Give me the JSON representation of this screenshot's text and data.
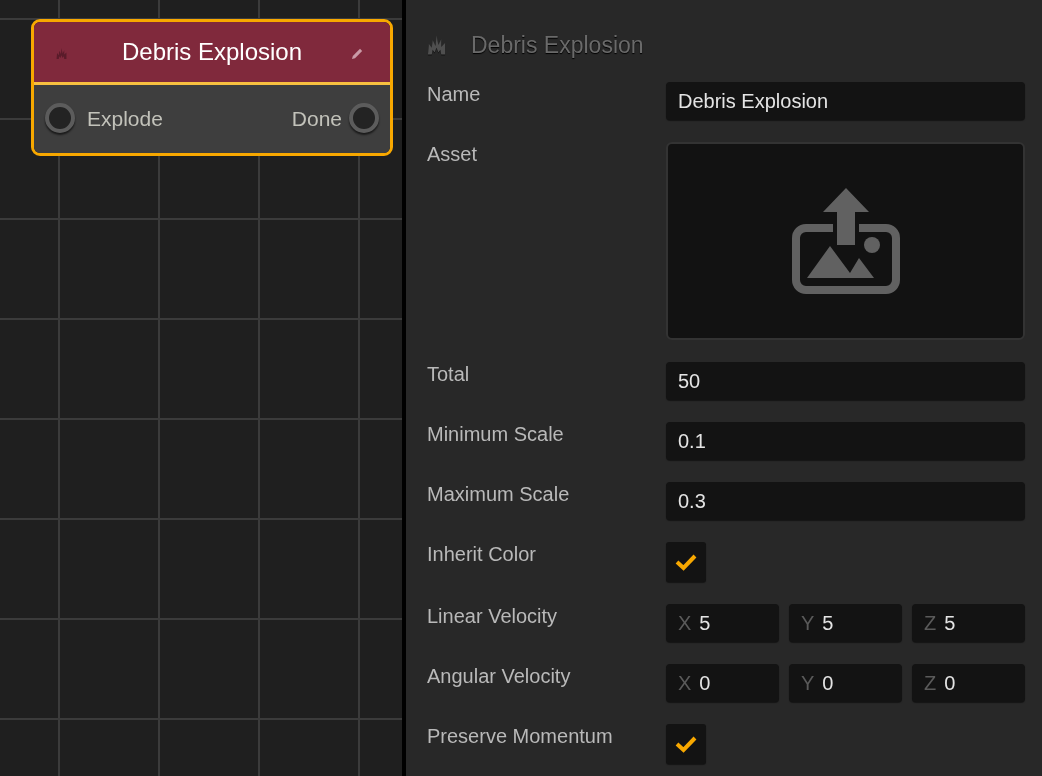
{
  "node": {
    "title": "Debris Explosion",
    "selected": true,
    "inputs": [
      {
        "label": "Explode"
      }
    ],
    "outputs": [
      {
        "label": "Done"
      }
    ]
  },
  "inspector": {
    "title": "Debris Explosion",
    "properties": [
      {
        "kind": "text",
        "label": "Name",
        "value": "Debris Explosion"
      },
      {
        "kind": "asset",
        "label": "Asset"
      },
      {
        "kind": "text",
        "label": "Total",
        "value": "50"
      },
      {
        "kind": "text",
        "label": "Minimum Scale",
        "value": "0.1"
      },
      {
        "kind": "text",
        "label": "Maximum Scale",
        "value": "0.3"
      },
      {
        "kind": "checkbox",
        "label": "Inherit Color",
        "checked": true
      },
      {
        "kind": "vector",
        "label": "Linear Velocity",
        "components": [
          {
            "axis": "X",
            "value": "5"
          },
          {
            "axis": "Y",
            "value": "5"
          },
          {
            "axis": "Z",
            "value": "5"
          }
        ]
      },
      {
        "kind": "vector",
        "label": "Angular Velocity",
        "components": [
          {
            "axis": "X",
            "value": "0"
          },
          {
            "axis": "Y",
            "value": "0"
          },
          {
            "axis": "Z",
            "value": "0"
          }
        ]
      },
      {
        "kind": "checkbox",
        "label": "Preserve Momentum",
        "checked": true
      }
    ]
  }
}
